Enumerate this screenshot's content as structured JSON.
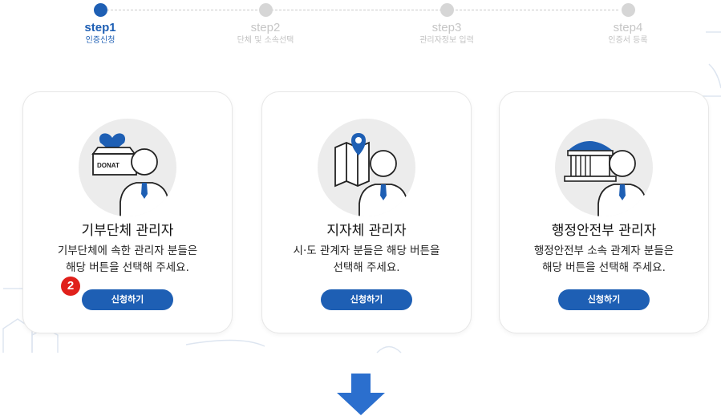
{
  "steps": [
    {
      "title": "step1",
      "subtitle": "인증신청",
      "active": true
    },
    {
      "title": "step2",
      "subtitle": "단체 및 소속선택",
      "active": false
    },
    {
      "title": "step3",
      "subtitle": "관리자정보 입력",
      "active": false
    },
    {
      "title": "step4",
      "subtitle": "인증서 등록",
      "active": false
    }
  ],
  "cards": [
    {
      "icon": "donation-box-icon",
      "illus_text": "DONAT",
      "title": "기부단체 관리자",
      "description": "기부단체에 속한 관리자 분들은\n해당 버튼을 선택해 주세요.",
      "button": "신청하기"
    },
    {
      "icon": "map-pin-icon",
      "title": "지자체 관리자",
      "description": "시·도 관계자 분들은 해당 버튼을\n선택해 주세요.",
      "button": "신청하기"
    },
    {
      "icon": "government-building-icon",
      "title": "행정안전부 관리자",
      "description": "행정안전부 소속 관계자 분들은\n해당 버튼을 선택해 주세요.",
      "button": "신청하기"
    }
  ],
  "annotation_badge": "2",
  "colors": {
    "primary": "#1e5fb4",
    "badge": "#e0201b",
    "inactive": "#d6d6d6"
  },
  "down_arrow_icon": "arrow-down-icon"
}
